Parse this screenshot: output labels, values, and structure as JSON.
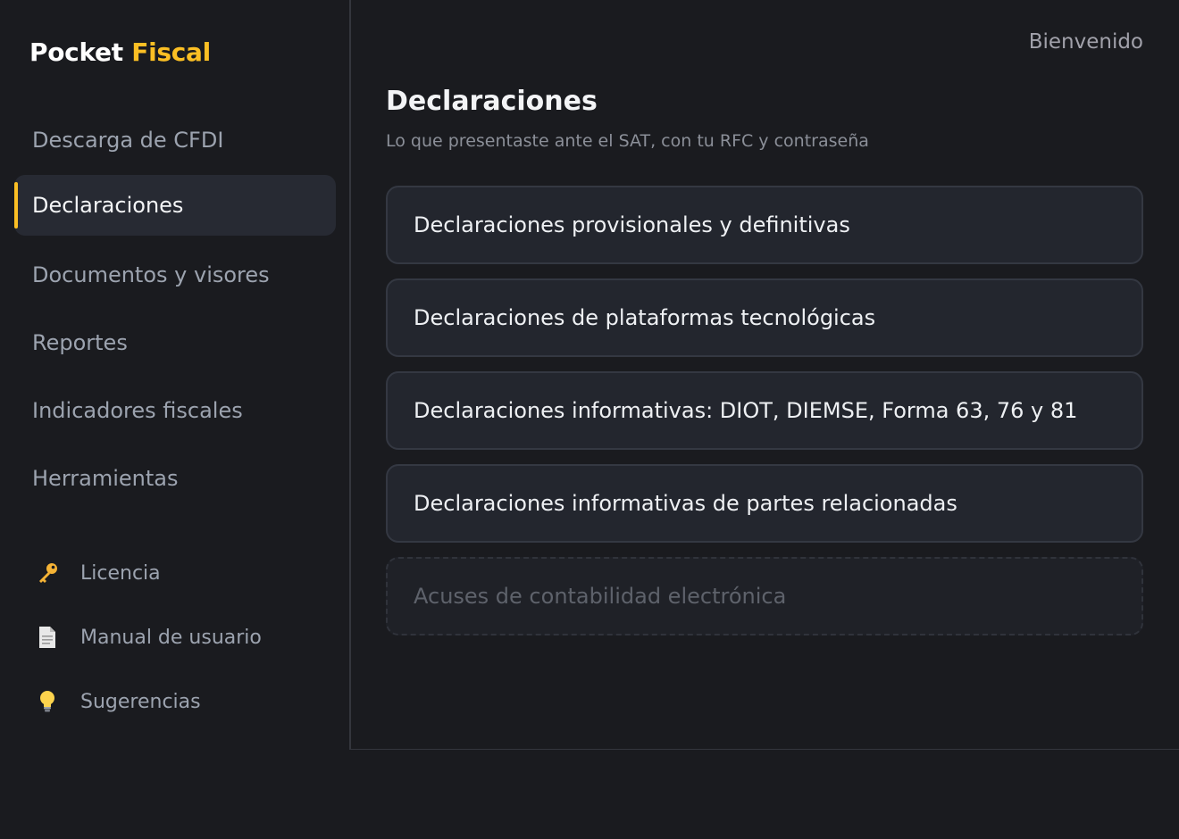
{
  "brand": {
    "part1": "Pocket",
    "part2": "Fiscal",
    "accent_color": "#fbbf24"
  },
  "header": {
    "welcome": "Bienvenido"
  },
  "sidebar": {
    "items": [
      {
        "label": "Descarga de CFDI",
        "active": false
      },
      {
        "label": "Declaraciones",
        "active": true
      },
      {
        "label": "Documentos y visores",
        "active": false
      },
      {
        "label": "Reportes",
        "active": false
      },
      {
        "label": "Indicadores fiscales",
        "active": false
      },
      {
        "label": "Herramientas",
        "active": false
      }
    ],
    "extras": [
      {
        "label": "Licencia",
        "icon": "key-icon"
      },
      {
        "label": "Manual de usuario",
        "icon": "document-icon"
      },
      {
        "label": "Sugerencias",
        "icon": "lightbulb-icon"
      }
    ]
  },
  "main": {
    "title": "Declaraciones",
    "subtitle": "Lo que presentaste ante el SAT, con tu RFC y contraseña",
    "cards": [
      {
        "label": "Declaraciones provisionales y definitivas",
        "enabled": true
      },
      {
        "label": "Declaraciones de plataformas tecnológicas",
        "enabled": true
      },
      {
        "label": "Declaraciones informativas: DIOT, DIEMSE, Forma 63, 76 y 81",
        "enabled": true
      },
      {
        "label": "Declaraciones informativas de partes relacionadas",
        "enabled": true
      },
      {
        "label": "Acuses de contabilidad electrónica",
        "enabled": false
      }
    ]
  }
}
